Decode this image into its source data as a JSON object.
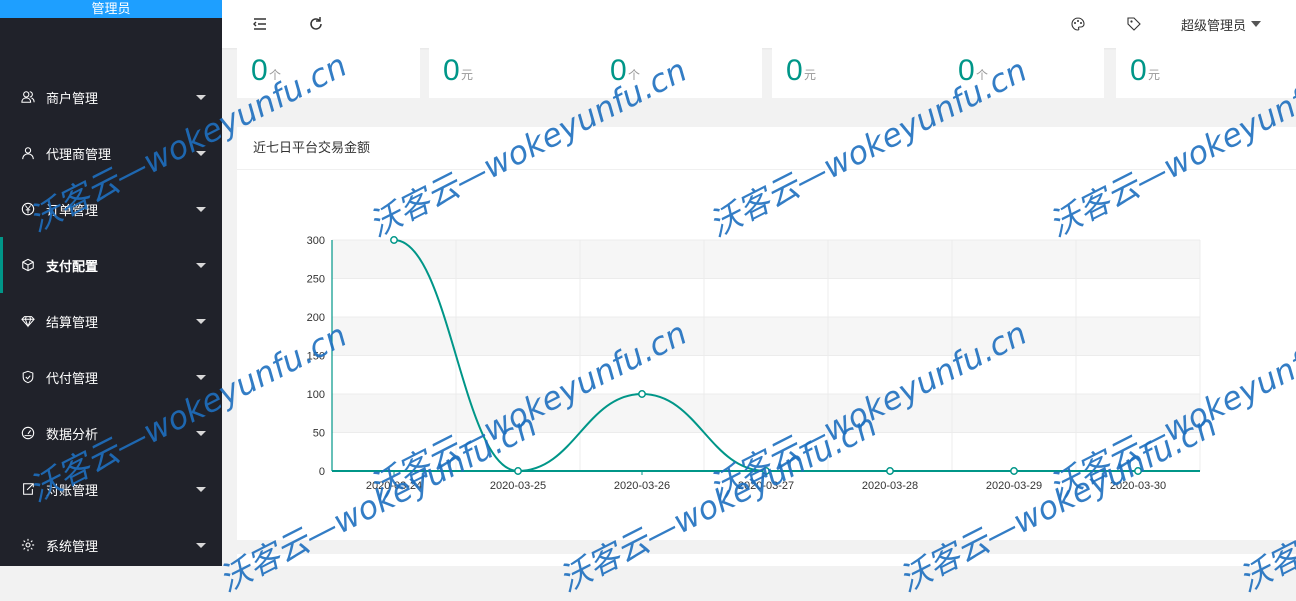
{
  "sidebar": {
    "brand": "管理员",
    "items": [
      {
        "label": "商户管理",
        "icon": "user-group-icon",
        "active": false
      },
      {
        "label": "代理商管理",
        "icon": "user-icon",
        "active": false
      },
      {
        "label": "订单管理",
        "icon": "yen-circle-icon",
        "active": false
      },
      {
        "label": "支付配置",
        "icon": "cube-icon",
        "active": true
      },
      {
        "label": "结算管理",
        "icon": "diamond-icon",
        "active": false
      },
      {
        "label": "代付管理",
        "icon": "shield-icon",
        "active": false
      },
      {
        "label": "数据分析",
        "icon": "gauge-icon",
        "active": false
      },
      {
        "label": "对账管理",
        "icon": "export-icon",
        "active": false
      },
      {
        "label": "系统管理",
        "icon": "gear-icon",
        "active": false
      }
    ]
  },
  "header": {
    "menu_toggle_icon": "menu-fold-icon",
    "refresh_icon": "refresh-icon",
    "theme_icon": "palette-icon",
    "tag_icon": "tag-icon",
    "user_label": "超级管理员"
  },
  "stats": [
    {
      "value": "0",
      "unit": "个"
    },
    {
      "value": "0",
      "unit": "元"
    },
    {
      "value": "0",
      "unit": "个"
    },
    {
      "value": "0",
      "unit": "元"
    },
    {
      "value": "0",
      "unit": "个"
    },
    {
      "value": "0",
      "unit": "元"
    }
  ],
  "chart_card": {
    "title": "近七日平台交易金额"
  },
  "watermark": "沃客云—wokeyunfu.cn",
  "colors": {
    "accent": "#009688",
    "sidebar": "#20222a",
    "brand": "#1e9fff"
  },
  "chart_data": {
    "type": "line",
    "title": "近七日平台交易金额",
    "categories": [
      "2020-03-24",
      "2020-03-25",
      "2020-03-26",
      "2020-03-27",
      "2020-03-28",
      "2020-03-29",
      "2020-03-30"
    ],
    "series": [
      {
        "values": [
          300,
          0,
          100,
          0,
          0,
          0,
          0
        ]
      }
    ],
    "yticks": [
      "0",
      "50",
      "100",
      "150",
      "200",
      "250",
      "300"
    ],
    "ylim": [
      0,
      300
    ],
    "smooth": true,
    "grid": true,
    "xlabel": "",
    "ylabel": ""
  }
}
